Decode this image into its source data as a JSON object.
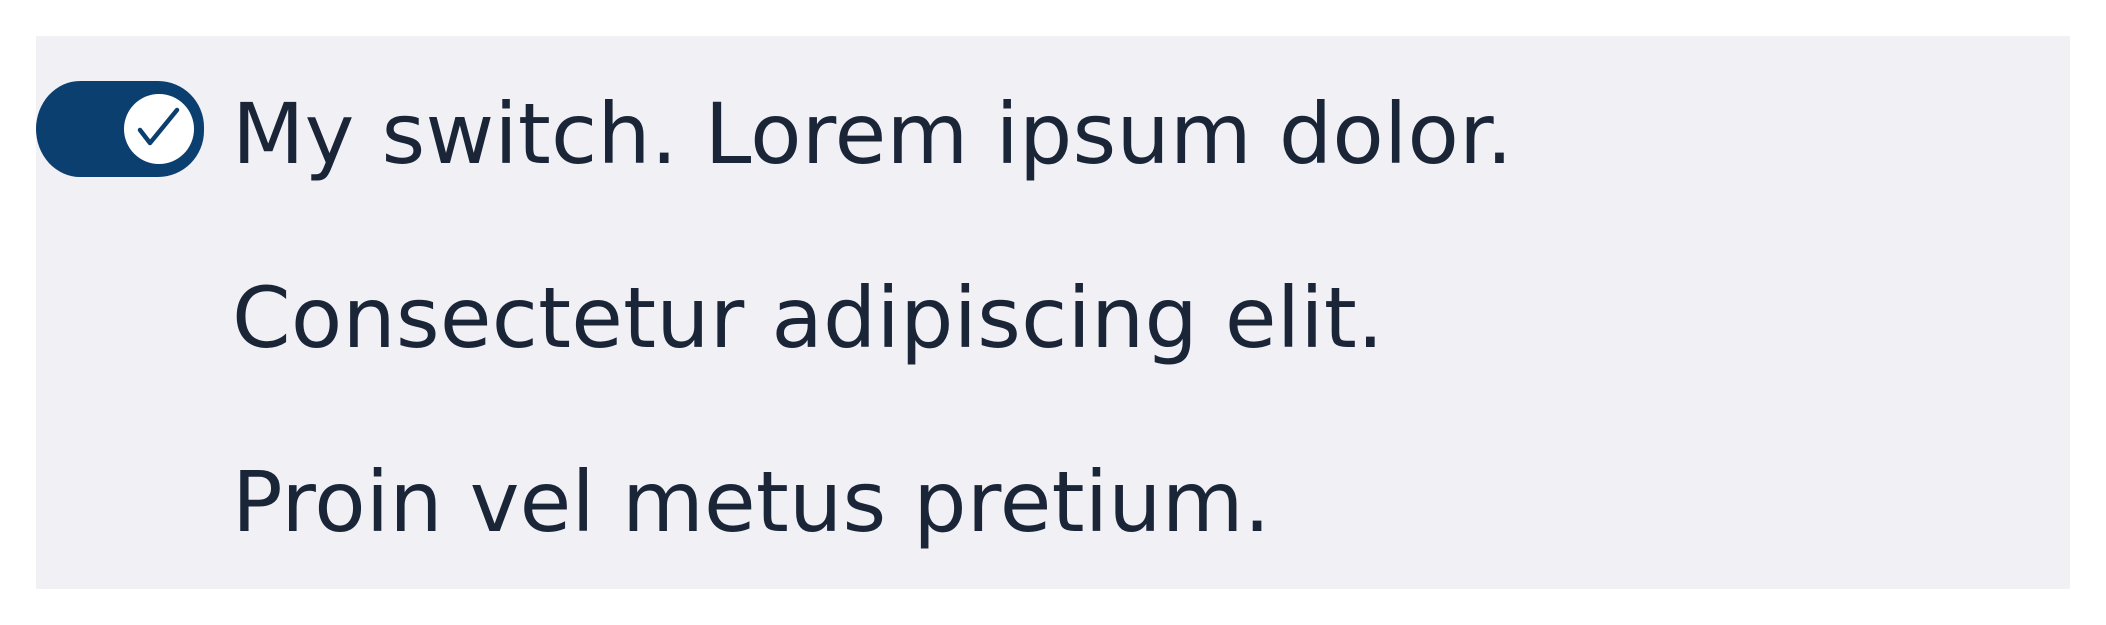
{
  "switch": {
    "checked": true,
    "label_lines": [
      "My switch. Lorem ipsum dolor.",
      "Consectetur adipiscing elit.",
      "Proin vel metus pretium."
    ]
  },
  "colors": {
    "panel_background": "#f1f0f5",
    "switch_on": "#0b3f6f",
    "thumb": "#ffffff",
    "text": "#1a2638"
  },
  "icons": {
    "thumb_icon": "check-icon"
  }
}
